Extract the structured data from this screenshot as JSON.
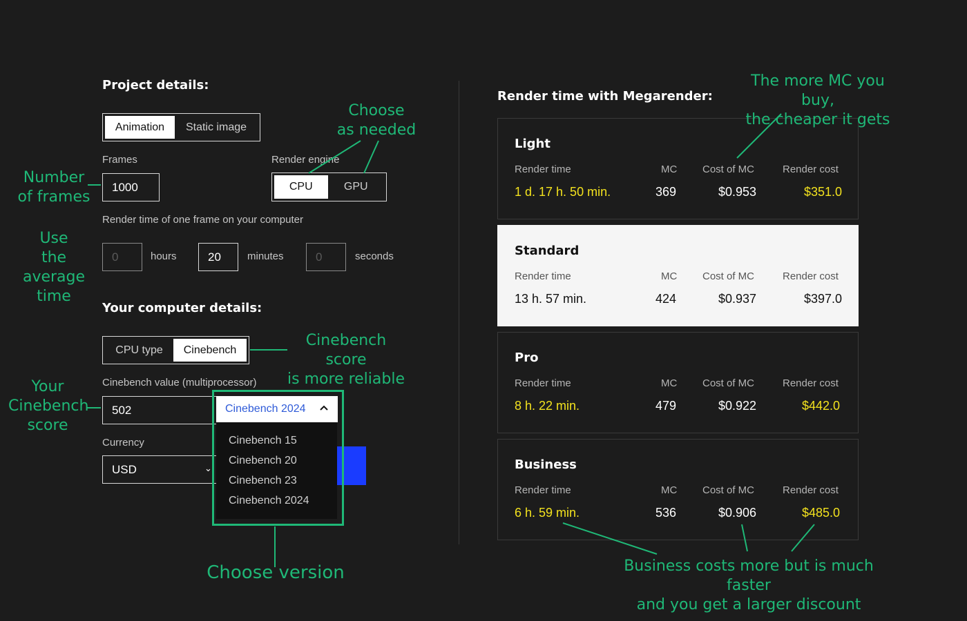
{
  "project": {
    "title": "Project details:",
    "mode_options": [
      "Animation",
      "Static image"
    ],
    "mode_selected": "Animation",
    "frames_label": "Frames",
    "frames_value": "1000",
    "engine_label": "Render engine",
    "engine_options": [
      "CPU",
      "GPU"
    ],
    "engine_selected": "CPU",
    "frame_time_label": "Render time of one frame on your computer",
    "hours_placeholder": "0",
    "hours_unit": "hours",
    "minutes_value": "20",
    "minutes_unit": "minutes",
    "seconds_placeholder": "0",
    "seconds_unit": "seconds"
  },
  "computer": {
    "title": "Your computer details:",
    "tabs": [
      "CPU type",
      "Cinebench"
    ],
    "tab_selected": "Cinebench",
    "cinebench_label": "Cinebench value (multiprocessor)",
    "cinebench_value": "502",
    "version_selected": "Cinebench 2024",
    "version_options": [
      "Cinebench 15",
      "Cinebench 20",
      "Cinebench 23",
      "Cinebench 2024"
    ],
    "currency_label": "Currency",
    "currency_value": "USD"
  },
  "results": {
    "title": "Render time with Megarender:",
    "headers": {
      "render_time": "Render time",
      "mc": "MC",
      "cost_of_mc": "Cost of MC",
      "render_cost": "Render cost"
    },
    "plans": [
      {
        "name": "Light",
        "render_time": "1 d. 17 h. 50 min.",
        "mc": "369",
        "cost_of_mc": "$0.953",
        "render_cost": "$351.0"
      },
      {
        "name": "Standard",
        "render_time": "13 h. 57 min.",
        "mc": "424",
        "cost_of_mc": "$0.937",
        "render_cost": "$397.0"
      },
      {
        "name": "Pro",
        "render_time": "8 h. 22 min.",
        "mc": "479",
        "cost_of_mc": "$0.922",
        "render_cost": "$442.0"
      },
      {
        "name": "Business",
        "render_time": "6 h. 59 min.",
        "mc": "536",
        "cost_of_mc": "$0.906",
        "render_cost": "$485.0"
      }
    ]
  },
  "annotations": {
    "choose_as_needed": [
      "Choose",
      "as needed"
    ],
    "number_of_frames": [
      "Number",
      "of frames"
    ],
    "use_average_time": [
      "Use",
      "the average",
      "time"
    ],
    "cinebench_reliable": [
      "Cinebench score",
      "is more reliable"
    ],
    "your_cinebench": [
      "Your",
      "Cinebench",
      "score"
    ],
    "choose_version": "Choose version",
    "more_mc": [
      "The more MC you buy,",
      "the cheaper it gets"
    ],
    "business": [
      "Business costs more but is much faster",
      "and you get a larger discount"
    ]
  },
  "colors": {
    "background": "#1c1c1c",
    "annotation_green": "#1fb877",
    "highlight_yellow": "#f3e21e",
    "accent_blue": "#1a3cff",
    "link_blue": "#2f5bd8"
  }
}
